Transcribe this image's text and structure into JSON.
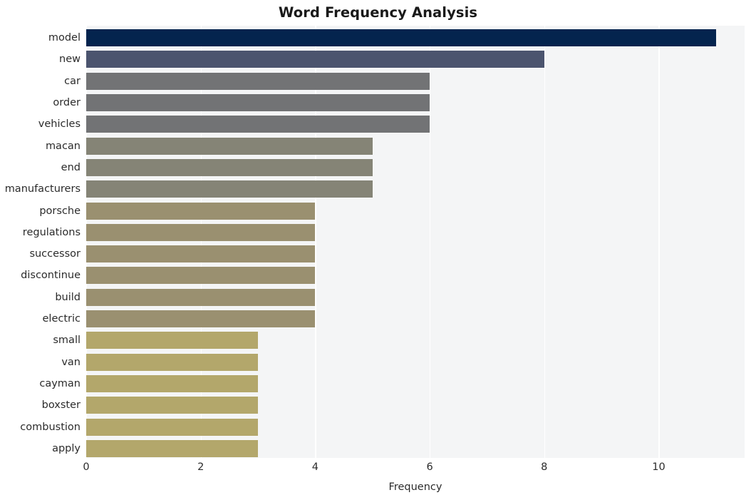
{
  "chart_data": {
    "type": "bar",
    "orientation": "horizontal",
    "title": "Word Frequency Analysis",
    "xlabel": "Frequency",
    "ylabel": "",
    "categories": [
      "model",
      "new",
      "car",
      "order",
      "vehicles",
      "macan",
      "end",
      "manufacturers",
      "porsche",
      "regulations",
      "successor",
      "discontinue",
      "build",
      "electric",
      "small",
      "van",
      "cayman",
      "boxster",
      "combustion",
      "apply"
    ],
    "values": [
      11,
      8,
      6,
      6,
      6,
      5,
      5,
      5,
      4,
      4,
      4,
      4,
      4,
      4,
      3,
      3,
      3,
      3,
      3,
      3
    ],
    "bar_colors": [
      "#04244e",
      "#4b546e",
      "#727375",
      "#727375",
      "#727375",
      "#858476",
      "#858476",
      "#858476",
      "#9a9070",
      "#9a9070",
      "#9a9070",
      "#9a9070",
      "#9a9070",
      "#9a9070",
      "#b3a76b",
      "#b3a76b",
      "#b3a76b",
      "#b3a76b",
      "#b3a76b",
      "#b3a76b"
    ],
    "xlim": [
      0,
      11.5
    ],
    "xticks": [
      0,
      2,
      4,
      6,
      8,
      10
    ],
    "xtick_labels": [
      "0",
      "2",
      "4",
      "6",
      "8",
      "10"
    ],
    "grid": true,
    "grid_axis": "x",
    "grid_color": "#ffffff",
    "plot_background": "#f4f5f6",
    "figure_background": "#ffffff",
    "legend": null,
    "style": "whitegrid"
  }
}
